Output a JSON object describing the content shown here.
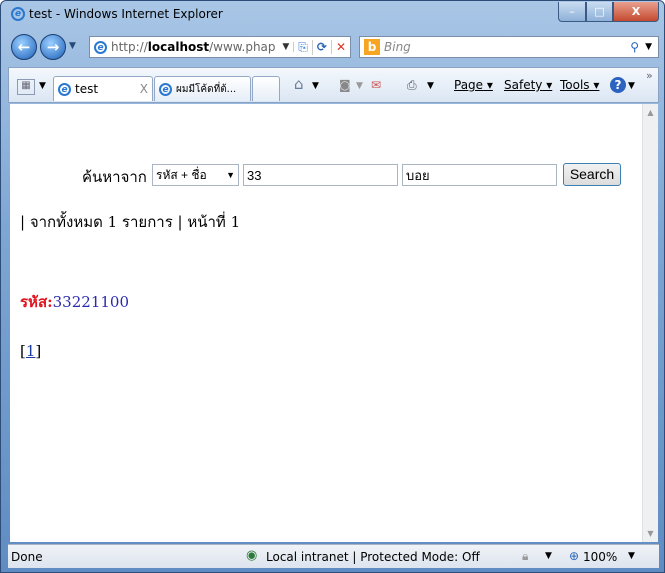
{
  "window": {
    "title": "test - Windows Internet Explorer",
    "min": "–",
    "max": "□",
    "close": "X"
  },
  "address": {
    "prefix": "http://",
    "host": "localhost",
    "path": "/www.phap"
  },
  "search_box": {
    "placeholder": "Bing",
    "logo": "b"
  },
  "tabs": [
    {
      "label": "test",
      "close": "X"
    },
    {
      "label": "ผมมีโค้ดที่ต้..."
    }
  ],
  "commands": {
    "page": "Page",
    "safety": "Safety",
    "tools": "Tools",
    "help": "?",
    "more": "»"
  },
  "form": {
    "label": "ค้นหาจาก",
    "select_value": "รหัส + ชื่อ",
    "input1": "33",
    "input2": "บอย",
    "button": "Search"
  },
  "summary": "| จากทั้งหมด 1 รายการ | หน้าที่ 1",
  "result": {
    "key": "รหัส:",
    "value": "33221100"
  },
  "pager": {
    "open": "[",
    "page": "1",
    "close": "]"
  },
  "status": {
    "text": "Done",
    "zone": "Local intranet | Protected Mode: Off",
    "zoom": "100%"
  }
}
